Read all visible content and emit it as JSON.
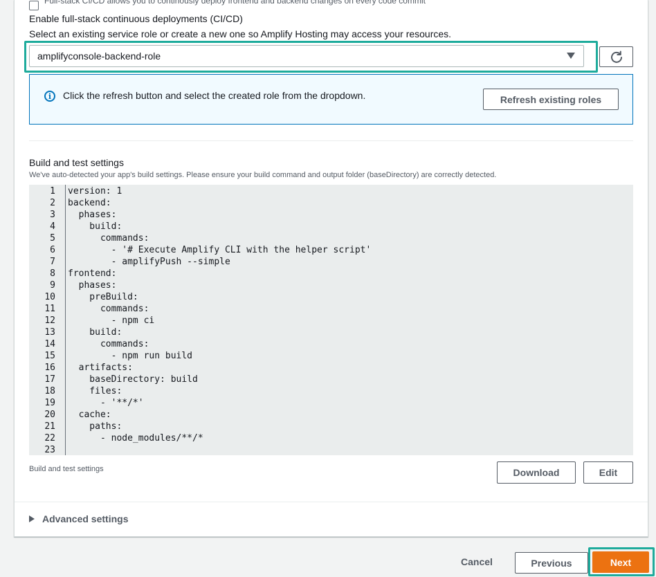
{
  "cicd": {
    "checkbox_text": "Full-stack CI/CD allows you to continously deploy frontend and backend changes on every code commit",
    "label": "Enable full-stack continuous deployments (CI/CD)",
    "description": "Select an existing service role or create a new one so Amplify Hosting may access your resources."
  },
  "role_select": {
    "selected_value": "amplifyconsole-backend-role",
    "refresh_icon": "refresh-icon"
  },
  "info_alert": {
    "icon": "info-icon",
    "message": "Click the refresh button and select the created role from the dropdown.",
    "button_label": "Refresh existing roles"
  },
  "build_settings": {
    "title": "Build and test settings",
    "description": "We've auto-detected your app's build settings. Please ensure your build command and output folder (baseDirectory) are correctly detected.",
    "caption": "Build and test settings",
    "download_label": "Download",
    "edit_label": "Edit",
    "code_lines": [
      "version: 1",
      "backend:",
      "  phases:",
      "    build:",
      "      commands:",
      "        - '# Execute Amplify CLI with the helper script'",
      "        - amplifyPush --simple",
      "frontend:",
      "  phases:",
      "    preBuild:",
      "      commands:",
      "        - npm ci",
      "    build:",
      "      commands:",
      "        - npm run build",
      "  artifacts:",
      "    baseDirectory: build",
      "    files:",
      "      - '**/*'",
      "  cache:",
      "    paths:",
      "      - node_modules/**/*",
      ""
    ]
  },
  "advanced": {
    "label": "Advanced settings",
    "icon": "caret-right-icon"
  },
  "footer": {
    "cancel_label": "Cancel",
    "previous_label": "Previous",
    "next_label": "Next"
  },
  "colors": {
    "highlight": "#1eab9c",
    "primary": "#ec7211",
    "info_border": "#0073bb",
    "info_bg": "#f1faff"
  }
}
